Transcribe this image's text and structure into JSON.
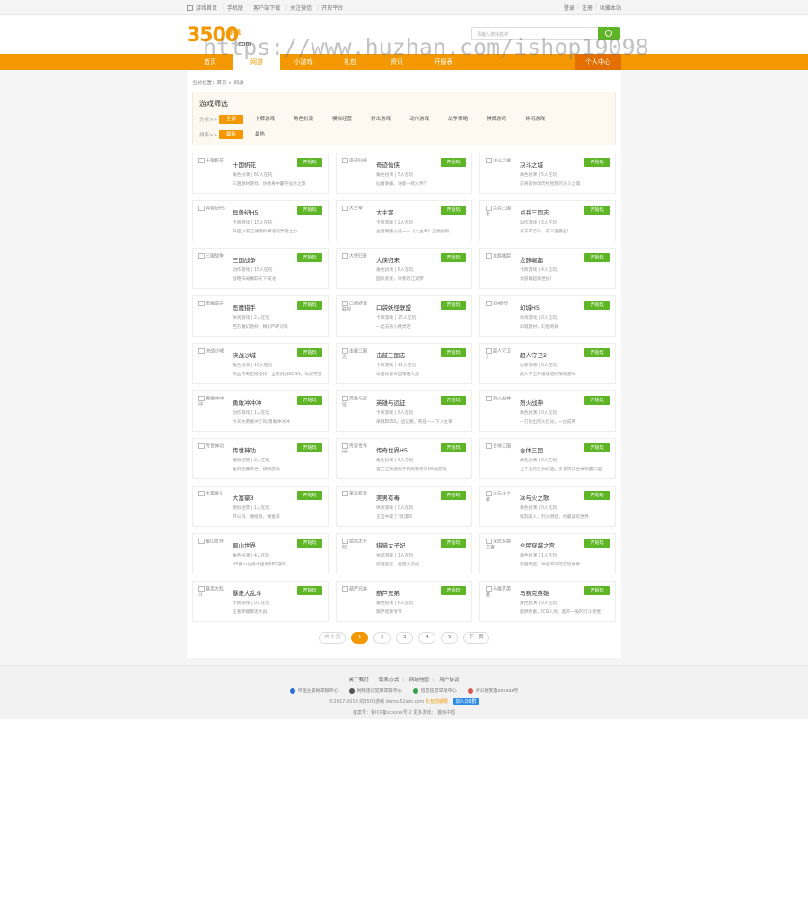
{
  "topbar": {
    "left": [
      "游戏首页",
      "手机版",
      "客户端下载",
      "关注微信",
      "开放平台"
    ],
    "right": [
      "登录",
      "注册",
      "收藏本站"
    ]
  },
  "logo": {
    "number": "3500",
    "game": "游戏",
    "com": ".com"
  },
  "search": {
    "placeholder": "请输入游戏名称"
  },
  "watermark": "https://www.huzhan.com/ishop19098",
  "nav": {
    "items": [
      "首页",
      "网游",
      "小游戏",
      "礼包",
      "资讯",
      "开服表"
    ],
    "active": 1,
    "user_center": "个人中心"
  },
  "breadcrumb": "当前位置：首页 > 网游",
  "filter": {
    "title": "游戏筛选",
    "category_label": "分类>>",
    "categories": [
      "全部",
      "卡牌游戏",
      "角色扮演",
      "模拟经营",
      "射击游戏",
      "动作游戏",
      "战争策略",
      "棋牌游戏",
      "休闲游戏"
    ],
    "sort_label": "排序>>",
    "sorts": [
      "最新",
      "最热"
    ]
  },
  "games": [
    {
      "name": "十国帆花",
      "meta": "角色扮演 | 60人在玩",
      "desc": "三国题材游戏，仿佛身中霸存仙亦之旅",
      "btn": "开始玩"
    },
    {
      "name": "奇迹仙侠",
      "meta": "角色扮演 | 5人在玩",
      "desc": "仙魔争霸、谁能一统六界?",
      "btn": "开始玩"
    },
    {
      "name": "决斗之城",
      "meta": "角色扮演 | 5人在玩",
      "desc": "这将是你的历经险阻的决斗之城",
      "btn": "开始玩"
    },
    {
      "name": "异兽纪H5",
      "meta": "卡牌游戏 | 15人在玩",
      "desc": "开启小说江湖模拟神话的异兽之力",
      "btn": "开始玩"
    },
    {
      "name": "大主宰",
      "meta": "卡牌游戏 | 2人在玩",
      "desc": "主题网络小说——《大主宰》正版授权",
      "btn": "开始玩"
    },
    {
      "name": "点兵三国志",
      "meta": "动作游戏 | 3人在玩",
      "desc": "点千军万马、成三国霸业!",
      "btn": "开始玩"
    },
    {
      "name": "三国战争",
      "meta": "动作游戏 | 15人在玩",
      "desc": "战略布局赢取天下城池",
      "btn": "开始玩"
    },
    {
      "name": "大侠归来",
      "meta": "角色扮演 | 6人在玩",
      "desc": "国风武侠，你我的江湖梦",
      "btn": "开始玩"
    },
    {
      "name": "龙族崛起",
      "meta": "卡牌游戏 | 4人在玩",
      "desc": "龙族崛起新世纪!",
      "btn": "开始玩"
    },
    {
      "name": "恶魔猎手",
      "meta": "休闲游戏 | 2人在玩",
      "desc": "西方魔幻题材，精彩PVP对决",
      "btn": "开始玩"
    },
    {
      "name": "口袋妖怪联盟",
      "meta": "卡牌游戏 | 25人在玩",
      "desc": "一起去抓小精灵吧",
      "btn": "开始玩"
    },
    {
      "name": "幻城H5",
      "meta": "休闲游戏 | 0人在玩",
      "desc": "幻城题材，幻想奇缘",
      "btn": "开始玩"
    },
    {
      "name": "决战沙城",
      "meta": "角色扮演 | 15人在玩",
      "desc": "热血传奇正版授权，全民挑战BOSS，攻城夺宝",
      "btn": "开始玩"
    },
    {
      "name": "击鼓三国志",
      "meta": "卡牌游戏 | 11人在玩",
      "desc": "攻击防御三国策略大战",
      "btn": "开始玩"
    },
    {
      "name": "超人守卫2",
      "meta": "战争策略 | 0人在玩",
      "desc": "超人守卫升级版塔防策略游戏",
      "btn": "开始玩"
    },
    {
      "name": "勇敢冲冲冲",
      "meta": "动作游戏 | 1人在玩",
      "desc": "今天你勇敢冲了吗 勇敢冲冲冲",
      "btn": "开始玩"
    },
    {
      "name": "英雄与远征",
      "meta": "卡牌游戏 | 8人在玩",
      "desc": "单挑BOSS，远征路，英雄一一下入主宰",
      "btn": "开始玩"
    },
    {
      "name": "烈火战神",
      "meta": "角色扮演 | 0人在玩",
      "desc": "一刀砍出烈火红光，一战成神",
      "btn": "开始玩"
    },
    {
      "name": "传世神功",
      "meta": "模拟经营 | 2人在玩",
      "desc": "复刻经典传世，横跨游戏",
      "btn": "开始玩"
    },
    {
      "name": "传奇世界H5",
      "meta": "角色扮演 | 6人在玩",
      "desc": "官方正版授权手机玩转传奇H5版游戏",
      "btn": "开始玩"
    },
    {
      "name": "合体三国",
      "meta": "角色扮演 | 0人在玩",
      "desc": "上千名将任你挑选，多重阵法合体称霸三国",
      "btn": "开始玩"
    },
    {
      "name": "大富豪3",
      "meta": "模拟经营 | 1人在玩",
      "desc": "开公司、赚投资，做富豪",
      "btn": "开始玩"
    },
    {
      "name": "美男有毒",
      "meta": "休闲游戏 | 0人在玩",
      "desc": "王宫中藏了!浪漫风",
      "btn": "开始玩"
    },
    {
      "name": "冰与火之歌",
      "meta": "角色扮演 | 0人在玩",
      "desc": "铭刻美人、烈火燃烧，你最喜欢世界",
      "btn": "开始玩"
    },
    {
      "name": "蜀山世界",
      "meta": "角色扮演 | 4人在玩",
      "desc": "H5蜀山仙侠大世界RPG游戏",
      "btn": "开始玩"
    },
    {
      "name": "猎猎太子妃",
      "meta": "休闲游戏 | 1人在玩",
      "desc": "穿越后宫，重塑太子妃",
      "btn": "开始玩"
    },
    {
      "name": "全民穿越之宫",
      "meta": "角色扮演 | 1人在玩",
      "desc": "穿越时空，体验不同的宫廷故事",
      "btn": "开始玩"
    },
    {
      "name": "暴走大乱斗",
      "meta": "卡牌游戏 | 0人在玩",
      "desc": "王者荣耀暴走大战",
      "btn": "开始玩"
    },
    {
      "name": "葫芦兄弟",
      "meta": "角色扮演 | 6人在玩",
      "desc": "葫芦娃救爷爷",
      "btn": "开始玩"
    },
    {
      "name": "马赛克英雄",
      "meta": "角色扮演 | 0人在玩",
      "desc": "超燃像素、ICG入坑、超开一般的打斗感觉",
      "btn": "开始玩"
    }
  ],
  "pager": {
    "info": "共 5 页",
    "pages": [
      "1",
      "2",
      "3",
      "4",
      "5"
    ],
    "active": 0,
    "next": "下一页"
  },
  "footer": {
    "links": [
      "关于我们",
      "联系方式",
      "网站地图",
      "用户协议"
    ],
    "certs": [
      {
        "label": "中国互联网举报中心",
        "color": "#2b6fd6"
      },
      {
        "label": "网络违法犯罪举报中心",
        "color": "#555555"
      },
      {
        "label": "信息信息举报中心",
        "color": "#38a04a"
      },
      {
        "label": "河公网安备xxxxxx号",
        "color": "#d9534f"
      }
    ],
    "copy": "©2017-2018  的3500游戏  demo.52szn.com",
    "copy_brand": "礼包前期限",
    "qq": "加入QQ群",
    "icp": "备案号：鲁ICP备xxxxxx号-2   更多游戏：  猫仙中国"
  }
}
